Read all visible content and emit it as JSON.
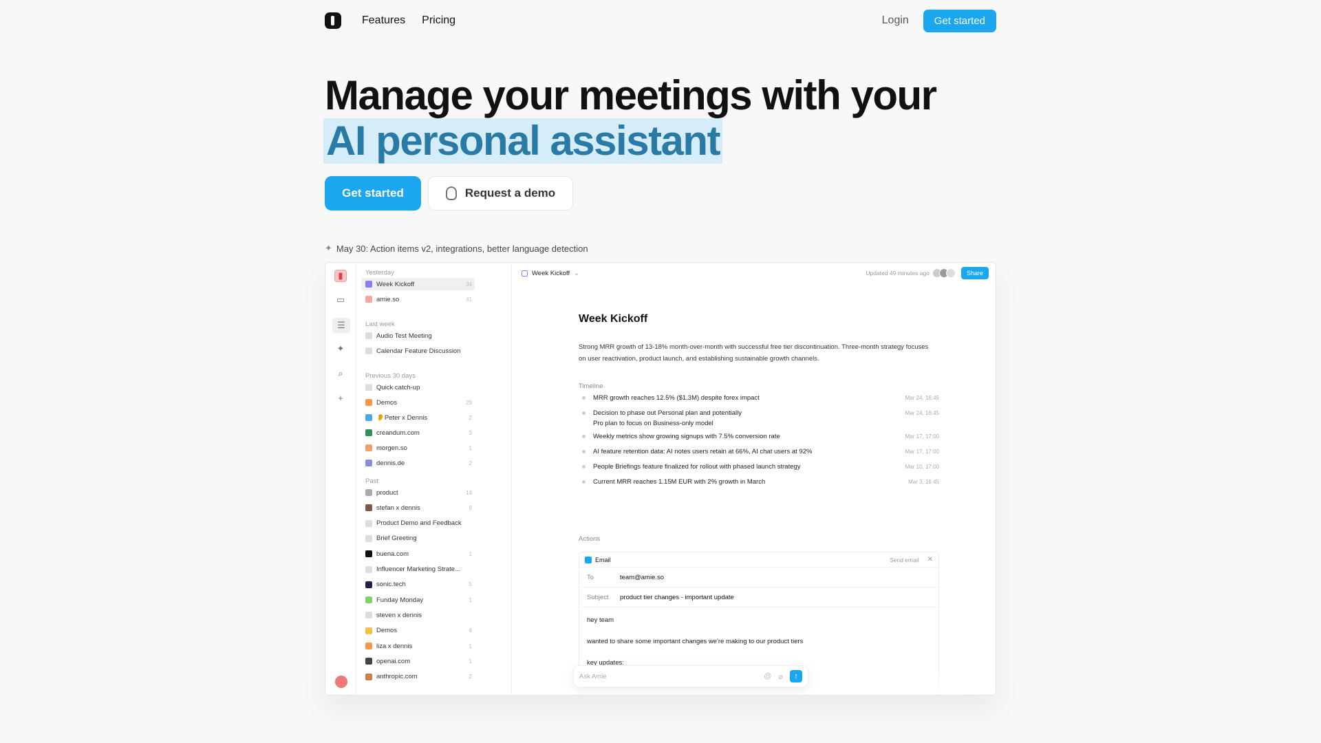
{
  "nav": {
    "features": "Features",
    "pricing": "Pricing",
    "login": "Login",
    "get_started": "Get started"
  },
  "hero": {
    "title_line1": "Manage your meetings with your",
    "title_line2": "AI personal assistant",
    "cta_primary": "Get started",
    "cta_secondary": "Request a demo"
  },
  "announcement": "May 30: Action items v2, integrations, better language detection",
  "app": {
    "sidebar": {
      "groups": [
        {
          "label": "Yesterday",
          "items": [
            {
              "label": "Week Kickoff",
              "count": "34",
              "selected": true,
              "color": "#8a7ff0"
            },
            {
              "label": "amie.so",
              "count": "41",
              "color": "#f7a3a3"
            }
          ]
        },
        {
          "label": "Last week",
          "items": [
            {
              "label": "Audio Test Meeting",
              "count": "",
              "color": "#dddddd"
            },
            {
              "label": "Calendar Feature Discussion",
              "count": "",
              "color": "#dddddd"
            }
          ]
        },
        {
          "label": "Previous 30 days",
          "items": [
            {
              "label": "Quick catch-up",
              "count": "",
              "color": "#dddddd"
            },
            {
              "label": "Demos",
              "count": "29",
              "color": "#f2994a"
            },
            {
              "label": "👂Peter x Dennis",
              "count": "2",
              "color": "#4aa8e8"
            },
            {
              "label": "creandum.com",
              "count": "3",
              "color": "#2f8f5b"
            },
            {
              "label": "morgen.so",
              "count": "1",
              "color": "#f2a06a"
            },
            {
              "label": "dennis.de",
              "count": "2",
              "color": "#8a8ed8"
            }
          ]
        },
        {
          "label": "Past",
          "items": [
            {
              "label": "product",
              "count": "14",
              "color": "#aaaaaa"
            },
            {
              "label": "stefan x dennis",
              "count": "8",
              "color": "#7a5a4a"
            },
            {
              "label": "Product Demo and Feedback",
              "count": "",
              "color": "#dddddd"
            },
            {
              "label": "Brief Greeting",
              "count": "",
              "color": "#dddddd"
            },
            {
              "label": "buena.com",
              "count": "1",
              "color": "#111111"
            },
            {
              "label": "Influencer Marketing Strate...",
              "count": "",
              "color": "#dddddd"
            },
            {
              "label": "sonic.tech",
              "count": "5",
              "color": "#222244"
            },
            {
              "label": "Funday Monday",
              "count": "1",
              "color": "#7fd36a"
            },
            {
              "label": "steven x dennis",
              "count": "",
              "color": "#dddddd"
            },
            {
              "label": "Demos",
              "count": "4",
              "color": "#f2c14a"
            },
            {
              "label": "liza x dennis",
              "count": "1",
              "color": "#f2994a"
            },
            {
              "label": "openai.com",
              "count": "1",
              "color": "#444444"
            },
            {
              "label": "anthropic.com",
              "count": "2",
              "color": "#c9824a"
            }
          ]
        }
      ]
    },
    "topbar": {
      "title": "Week Kickoff",
      "updated": "Updated 49 minutes ago",
      "share": "Share"
    },
    "doc": {
      "title": "Week Kickoff",
      "summary": "Strong MRR growth of 13-18% month-over-month with successful free tier discontinuation. Three-month strategy focuses on user reactivation, product launch, and establishing sustainable growth channels.",
      "timeline_label": "Timeline",
      "timeline": [
        {
          "text": "MRR growth reaches 12.5% ($1.3M) despite forex impact",
          "date": "Mar 24, 16:45"
        },
        {
          "text": "Decision to phase out Personal plan and potentially\nPro plan to focus on Business-only model",
          "date": "Mar 24, 16:45"
        },
        {
          "text": "Weekly metrics show growing signups with 7.5% conversion rate",
          "date": "Mar 17, 17:00"
        },
        {
          "text": "AI feature retention data: AI notes users retain at 66%, AI chat users at 92%",
          "date": "Mar 17, 17:00"
        },
        {
          "text": "People Briefings feature finalized for rollout with phased launch strategy",
          "date": "Mar 10, 17:00"
        },
        {
          "text": "Current MRR reaches 1.15M EUR with 2% growth in March",
          "date": "Mar 3, 16:45"
        }
      ],
      "actions_label": "Actions",
      "email": {
        "header": "Email",
        "send": "Send email",
        "to_label": "To",
        "to_value": "team@amie.so",
        "subject_label": "Subject",
        "subject_value": "product tier changes - important update",
        "greeting": "hey team",
        "body": "wanted to share some important changes we're making to our product tiers",
        "partial": "key updates:"
      }
    },
    "ask": {
      "placeholder": "Ask Amie"
    }
  },
  "colors": {
    "accent": "#1aa7f0",
    "highlight_bg": "#d5ecf9",
    "highlight_text": "#2a7aa6"
  }
}
